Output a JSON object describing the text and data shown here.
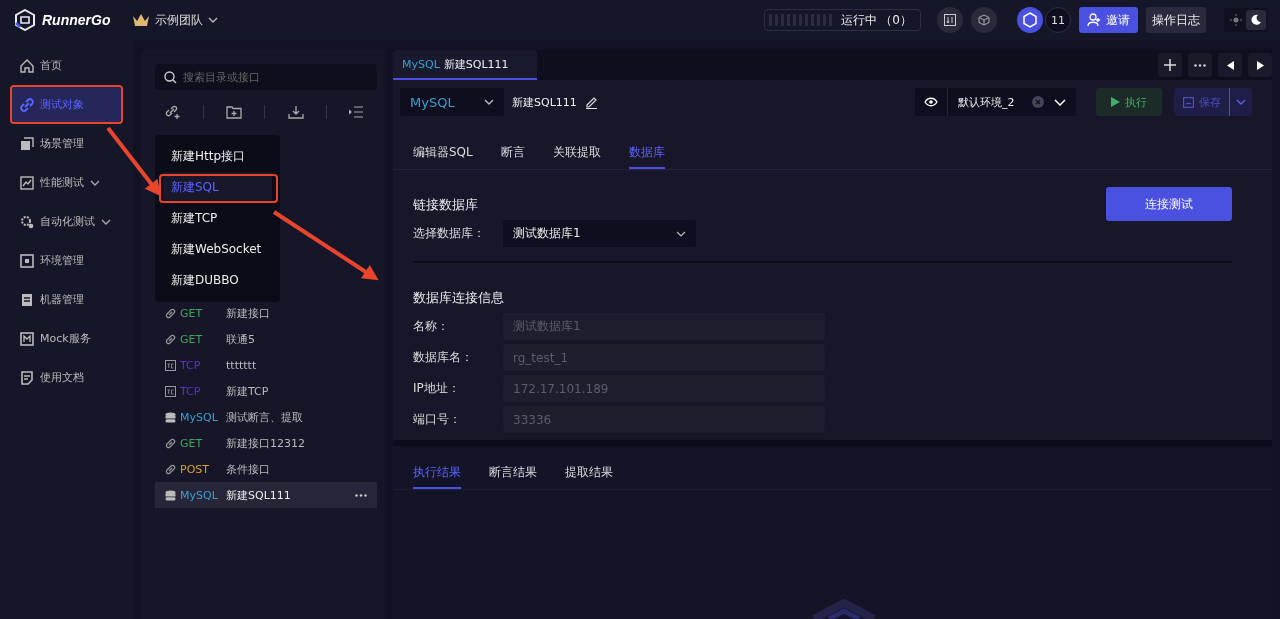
{
  "app": {
    "name": "RunnerGo",
    "team": "示例团队"
  },
  "header": {
    "running": "运行中 （0）",
    "count": "11",
    "invite": "邀请",
    "log": "操作日志",
    "dark_mode": true
  },
  "nav": [
    {
      "label": "首页",
      "selected": false,
      "highlighted": false,
      "expandable": false
    },
    {
      "label": "测试对象",
      "selected": true,
      "highlighted": true,
      "expandable": false
    },
    {
      "label": "场景管理",
      "selected": false,
      "highlighted": false,
      "expandable": false
    },
    {
      "label": "性能测试",
      "selected": false,
      "highlighted": false,
      "expandable": true
    },
    {
      "label": "自动化测试",
      "selected": false,
      "highlighted": false,
      "expandable": true
    },
    {
      "label": "环境管理",
      "selected": false,
      "highlighted": false,
      "expandable": false
    },
    {
      "label": "机器管理",
      "selected": false,
      "highlighted": false,
      "expandable": false
    },
    {
      "label": "Mock服务",
      "selected": false,
      "highlighted": false,
      "expandable": false
    },
    {
      "label": "使用文档",
      "selected": false,
      "highlighted": false,
      "expandable": false
    }
  ],
  "tree": {
    "placeholder": "搜索目录或接口",
    "menu": [
      {
        "label": "新建Http接口",
        "selected": false,
        "highlighted": false
      },
      {
        "label": "新建SQL",
        "selected": true,
        "highlighted": true
      },
      {
        "label": "新建TCP",
        "selected": false,
        "highlighted": false
      },
      {
        "label": "新建WebSocket",
        "selected": false,
        "highlighted": false
      },
      {
        "label": "新建DUBBO",
        "selected": false,
        "highlighted": false
      }
    ],
    "items": [
      {
        "kind": "http",
        "method": "GET",
        "color": "#3fa55a",
        "name": "新建接口",
        "selected": false
      },
      {
        "kind": "http",
        "method": "GET",
        "color": "#3fa55a",
        "name": "联通5",
        "selected": false
      },
      {
        "kind": "tcp",
        "method": "TCP",
        "color": "#5b2fc9",
        "name": "ttttttt",
        "selected": false
      },
      {
        "kind": "tcp",
        "method": "TCP",
        "color": "#5b2fc9",
        "name": "新建TCP",
        "selected": false
      },
      {
        "kind": "sql",
        "method": "MySQL",
        "color": "#3a9fd0",
        "name": "测试断言、提取",
        "selected": false
      },
      {
        "kind": "http",
        "method": "GET",
        "color": "#3fa55a",
        "name": "新建接口12312",
        "selected": false
      },
      {
        "kind": "http",
        "method": "POST",
        "color": "#d9a128",
        "name": "条件接口",
        "selected": false
      },
      {
        "kind": "sql",
        "method": "MySQL",
        "color": "#3a9fd0",
        "name": "新建SQL111",
        "selected": true
      }
    ]
  },
  "tabs": [
    {
      "method": "MySQL",
      "title": "新建SQL111",
      "selected": true
    }
  ],
  "toolbar": {
    "type": "MySQL",
    "name": "新建SQL111",
    "env": "默认环境_2",
    "run": "执行",
    "save": "保存"
  },
  "subtabs": [
    {
      "label": "编辑器SQL",
      "selected": false
    },
    {
      "label": "断言",
      "selected": false
    },
    {
      "label": "关联提取",
      "selected": false
    },
    {
      "label": "数据库",
      "selected": true
    }
  ],
  "db": {
    "title": "链接数据库",
    "select_label": "选择数据库：",
    "select_value": "测试数据库1",
    "test_button": "连接测试",
    "info_title": "数据库连接信息",
    "fields": [
      {
        "label": "名称：",
        "value": "测试数据库1"
      },
      {
        "label": "数据库名：",
        "value": "rg_test_1"
      },
      {
        "label": "IP地址：",
        "value": "172.17.101.189"
      },
      {
        "label": "端口号：",
        "value": "33336"
      }
    ]
  },
  "result_tabs": [
    {
      "label": "执行结果",
      "selected": true
    },
    {
      "label": "断言结果",
      "selected": false
    },
    {
      "label": "提取结果",
      "selected": false
    }
  ]
}
